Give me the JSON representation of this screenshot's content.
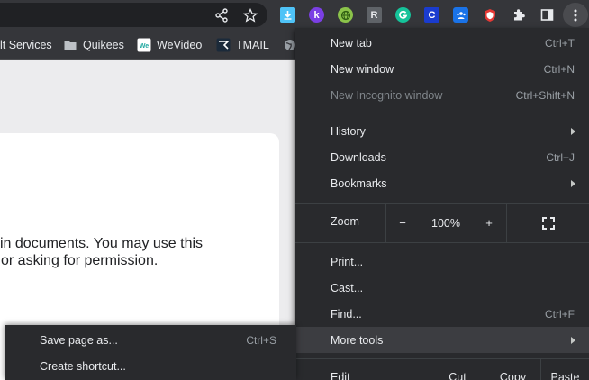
{
  "bookmarks": [
    {
      "label": "lt Services",
      "icon": "none"
    },
    {
      "label": "Quikees",
      "icon": "folder-icon"
    },
    {
      "label": "WeVideo",
      "icon": "wevideo-icon"
    },
    {
      "label": "TMAIL",
      "icon": "tmail-icon"
    }
  ],
  "extensions": {
    "r_letter": "R",
    "c_letter": "C",
    "k_letter": "k"
  },
  "page": {
    "line1": " in documents. You may use this",
    "line2": "or asking for permission."
  },
  "menu": {
    "new_tab": {
      "label": "New tab",
      "shortcut": "Ctrl+T"
    },
    "new_window": {
      "label": "New window",
      "shortcut": "Ctrl+N"
    },
    "new_incognito": {
      "label": "New Incognito window",
      "shortcut": "Ctrl+Shift+N"
    },
    "history": {
      "label": "History"
    },
    "downloads": {
      "label": "Downloads",
      "shortcut": "Ctrl+J"
    },
    "bookmarks": {
      "label": "Bookmarks"
    },
    "zoom": {
      "label": "Zoom",
      "minus": "−",
      "value": "100%",
      "plus": "+"
    },
    "print": {
      "label": "Print..."
    },
    "cast": {
      "label": "Cast..."
    },
    "find": {
      "label": "Find...",
      "shortcut": "Ctrl+F"
    },
    "more_tools": {
      "label": "More tools"
    },
    "edit": {
      "label": "Edit",
      "cut": "Cut",
      "copy": "Copy",
      "paste": "Paste"
    }
  },
  "submenu": {
    "save_page": {
      "label": "Save page as...",
      "shortcut": "Ctrl+S"
    },
    "create_shortcut": {
      "label": "Create shortcut..."
    }
  },
  "colors": {
    "menu_bg": "#292a2d",
    "toolbar_bg": "#35363a",
    "highlight": "#3c3d41"
  }
}
